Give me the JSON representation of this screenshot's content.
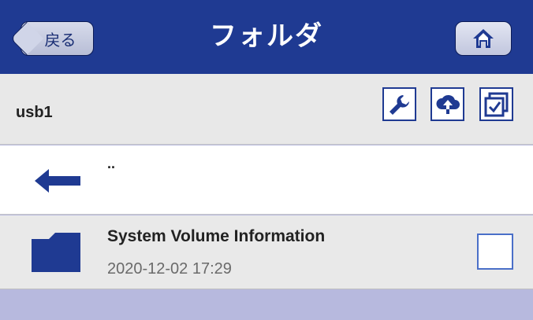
{
  "header": {
    "back_label": "戻る",
    "title": "フォルダ"
  },
  "pathbar": {
    "path": "usb1"
  },
  "file_list": {
    "parent_label": "..",
    "items": [
      {
        "name": "System Volume Information",
        "date": "2020-12-02 17:29",
        "checked": false
      }
    ]
  },
  "colors": {
    "header_bg": "#1f3a92",
    "icon_blue": "#1f3a92",
    "footer_bg": "#b7b9de"
  },
  "icons": [
    "home-icon",
    "wrench-icon",
    "cloud-upload-icon",
    "multi-select-icon",
    "back-arrow-icon",
    "folder-icon"
  ]
}
